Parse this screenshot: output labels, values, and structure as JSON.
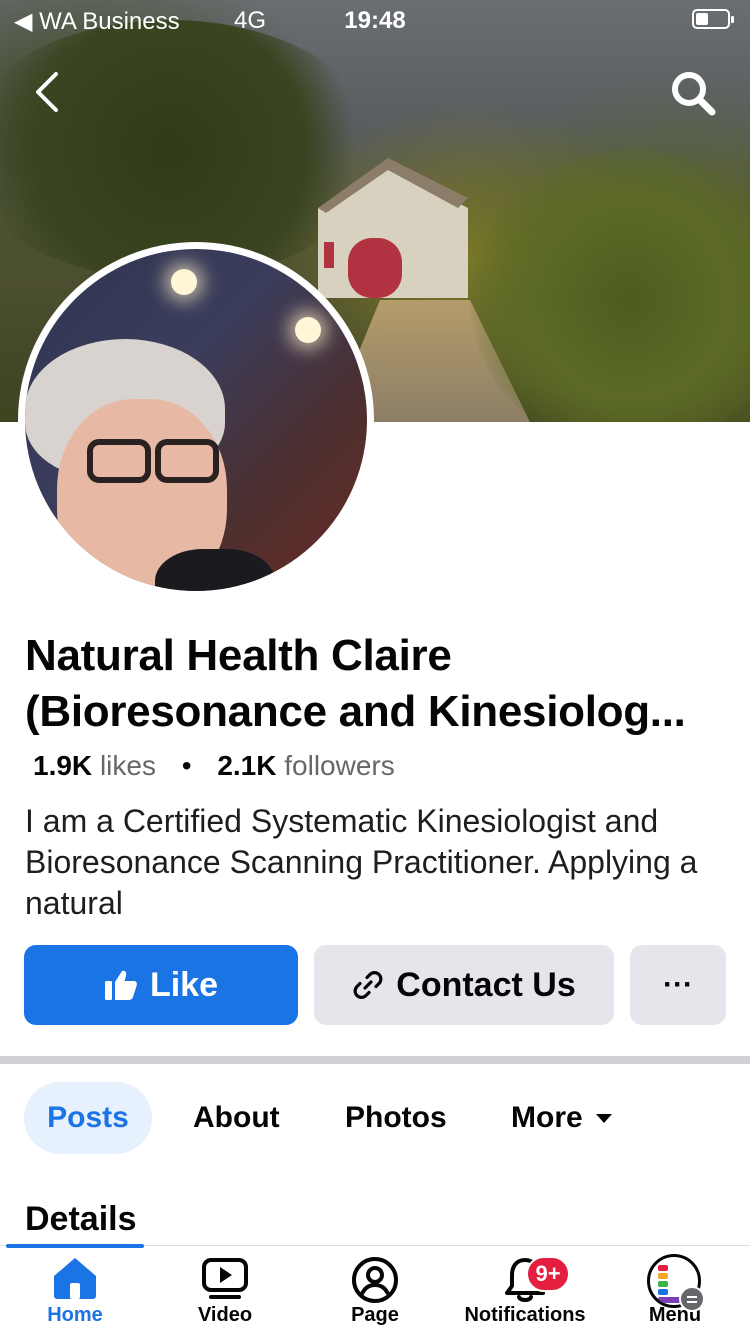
{
  "status_bar": {
    "carrier": "◀ WA Business",
    "network": "4G",
    "time": "19:48"
  },
  "page": {
    "name_line1": "Natural Health Claire",
    "name_line2": "(Bioresonance and Kinesiolog...",
    "likes_count": "1.9K",
    "likes_label": "likes",
    "separator": "•",
    "followers_count": "2.1K",
    "followers_label": "followers",
    "bio": "I am a Certified Systematic Kinesiologist and Bioresonance Scanning Practitioner. Applying a natural"
  },
  "actions": {
    "like": "Like",
    "contact": "Contact Us",
    "more": "···"
  },
  "tabs": [
    {
      "label": "Posts",
      "active": true
    },
    {
      "label": "About"
    },
    {
      "label": "Photos"
    },
    {
      "label": "More"
    }
  ],
  "section_title": "Details",
  "bottom_nav": [
    {
      "label": "Home",
      "icon": "home-icon",
      "active": true
    },
    {
      "label": "Video",
      "icon": "video-icon"
    },
    {
      "label": "Page",
      "icon": "page-icon"
    },
    {
      "label": "Notifications",
      "icon": "bell-icon",
      "badge": "9+"
    },
    {
      "label": "Menu",
      "icon": "menu-icon"
    }
  ],
  "colors": {
    "accent": "#1b74e4",
    "badge": "#e41e3f",
    "button_gray": "#e4e6eb"
  }
}
